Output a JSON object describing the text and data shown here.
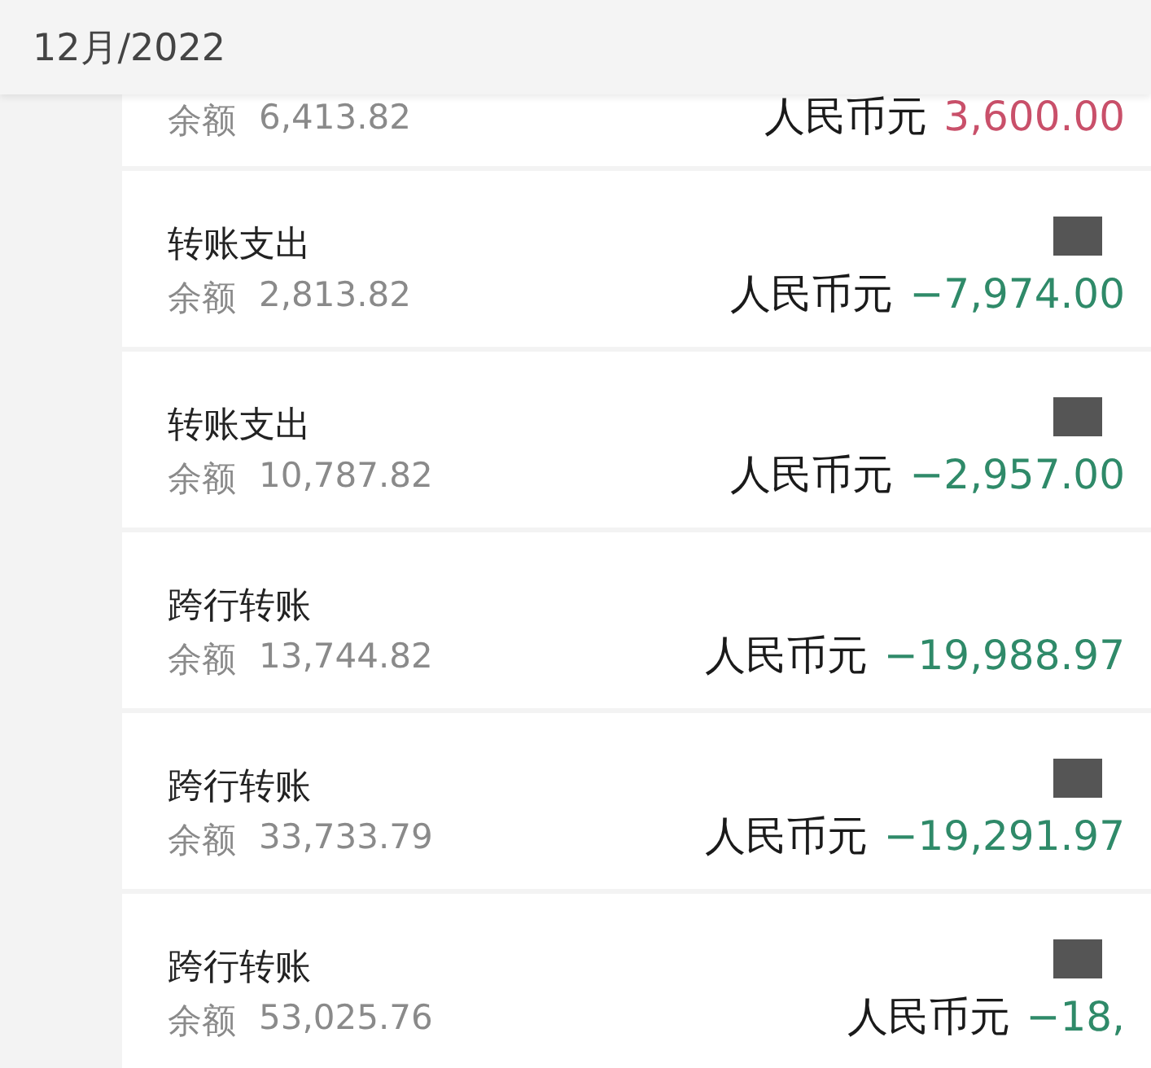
{
  "header": {
    "month": "12月/2022"
  },
  "transactions": [
    {
      "balance_label": "余额",
      "balance": "6,413.82",
      "currency": "人民币元",
      "amount": "3,600.00",
      "kind": "income",
      "redacted": false
    },
    {
      "title": "转账支出",
      "balance_label": "余额",
      "balance": "2,813.82",
      "currency": "人民币元",
      "amount": "−7,974.00",
      "kind": "expense",
      "redacted": true
    },
    {
      "title": "转账支出",
      "balance_label": "余额",
      "balance": "10,787.82",
      "currency": "人民币元",
      "amount": "−2,957.00",
      "kind": "expense",
      "redacted": true
    },
    {
      "title": "跨行转账",
      "balance_label": "余额",
      "balance": "13,744.82",
      "currency": "人民币元",
      "amount": "−19,988.97",
      "kind": "expense",
      "redacted": false
    },
    {
      "title": "跨行转账",
      "balance_label": "余额",
      "balance": "33,733.79",
      "currency": "人民币元",
      "amount": "−19,291.97",
      "kind": "expense",
      "redacted": true
    },
    {
      "title": "跨行转账",
      "balance_label": "余额",
      "balance": "53,025.76",
      "currency": "人民币元",
      "amount": "−18,",
      "kind": "expense",
      "redacted": true
    }
  ]
}
